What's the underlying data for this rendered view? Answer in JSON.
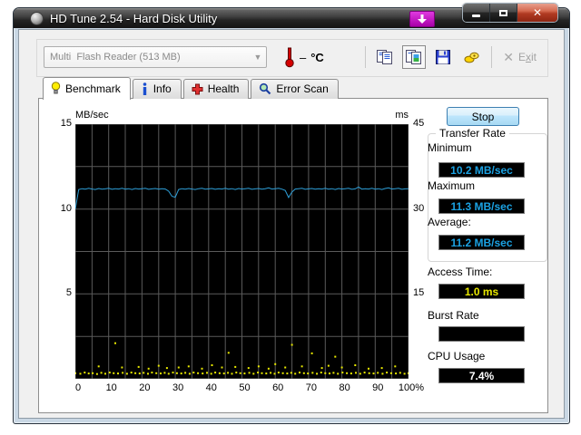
{
  "window": {
    "title": "HD Tune 2.54 - Hard Disk Utility"
  },
  "toolbar": {
    "device_select": "Multi  Flash Reader (513 MB)",
    "temperature": "–",
    "temperature_unit": "°C",
    "exit_label_pre": "E",
    "exit_label_underlined": "x",
    "exit_label_post": "it"
  },
  "tabs": [
    {
      "label": "Benchmark"
    },
    {
      "label": "Info"
    },
    {
      "label": "Health"
    },
    {
      "label": "Error Scan"
    }
  ],
  "controls": {
    "stop_button": "Stop"
  },
  "results": {
    "transfer_rate": {
      "group_label": "Transfer Rate",
      "minimum_label": "Minimum",
      "minimum_value": "10.2 MB/sec",
      "maximum_label": "Maximum",
      "maximum_value": "11.3 MB/sec",
      "average_label": "Average:",
      "average_value": "11.2 MB/sec"
    },
    "access_time_label": "Access Time:",
    "access_time_value": "1.0 ms",
    "burst_rate_label": "Burst Rate",
    "burst_rate_value": "",
    "cpu_usage_label": "CPU Usage",
    "cpu_usage_value": "7.4%"
  },
  "chart_data": {
    "type": "line",
    "left_axis": {
      "label": "MB/sec",
      "min": 0,
      "max": 15,
      "ticks": [
        15,
        10,
        5
      ]
    },
    "right_axis": {
      "label": "ms",
      "min": 0,
      "max": 45,
      "ticks": [
        45,
        30,
        15
      ]
    },
    "x_axis": {
      "min": 0,
      "max": 100,
      "tick_labels": [
        "0",
        "10",
        "20",
        "30",
        "40",
        "50",
        "60",
        "70",
        "80",
        "90",
        "100%"
      ]
    },
    "grid": {
      "x_divisions": 20,
      "y_divisions": 6,
      "line_color": "#5a5a5a",
      "bg_color": "#000000"
    },
    "series": [
      {
        "name": "transfer-rate",
        "type": "line",
        "axis": "left",
        "color": "#2e9fd8",
        "x_start": 0,
        "x_step": 1,
        "values": [
          10.0,
          11.15,
          11.2,
          11.17,
          11.22,
          11.18,
          11.15,
          11.21,
          11.17,
          11.19,
          11.22,
          11.16,
          11.2,
          11.18,
          11.22,
          11.17,
          11.2,
          11.15,
          11.21,
          11.18,
          11.2,
          11.22,
          11.16,
          11.19,
          11.21,
          11.17,
          11.2,
          11.18,
          11.05,
          10.75,
          10.7,
          11.15,
          11.2,
          11.17,
          11.21,
          11.18,
          11.15,
          11.2,
          11.22,
          11.17,
          11.19,
          11.21,
          11.16,
          11.2,
          11.18,
          11.22,
          11.17,
          11.2,
          11.15,
          11.21,
          11.18,
          11.2,
          11.22,
          11.16,
          11.19,
          11.21,
          11.17,
          11.2,
          11.25,
          11.18,
          11.2,
          11.22,
          11.17,
          11.1,
          10.68,
          11.0,
          11.18,
          11.2,
          11.22,
          11.16,
          11.19,
          11.21,
          11.17,
          11.2,
          11.18,
          11.22,
          11.17,
          11.2,
          11.15,
          11.21,
          11.18,
          11.2,
          11.22,
          11.16,
          11.19,
          11.3,
          11.17,
          11.2,
          11.18,
          11.22,
          11.17,
          11.2,
          11.15,
          11.21,
          11.25,
          11.18,
          11.2,
          11.22,
          11.16,
          11.19,
          11.2
        ]
      },
      {
        "name": "access-time",
        "type": "scatter",
        "axis": "right",
        "color": "#e8e800",
        "points": [
          [
            0,
            1.0
          ],
          [
            1.5,
            0.9
          ],
          [
            2.8,
            1.1
          ],
          [
            4,
            0.95
          ],
          [
            5.2,
            1.0
          ],
          [
            6.5,
            0.85
          ],
          [
            7,
            2.2
          ],
          [
            7.8,
            1.05
          ],
          [
            9,
            0.9
          ],
          [
            10.3,
            1.1
          ],
          [
            11.5,
            1.0
          ],
          [
            12,
            6.3
          ],
          [
            12.8,
            0.95
          ],
          [
            14,
            2.0
          ],
          [
            14.2,
            1.05
          ],
          [
            15.5,
            0.9
          ],
          [
            16.8,
            1.1
          ],
          [
            18,
            1.0
          ],
          [
            19,
            2.1
          ],
          [
            19.3,
            0.95
          ],
          [
            20.5,
            1.05
          ],
          [
            21.8,
            0.9
          ],
          [
            22,
            1.8
          ],
          [
            23,
            1.1
          ],
          [
            24.3,
            1.0
          ],
          [
            25,
            2.3
          ],
          [
            25.6,
            0.95
          ],
          [
            26.8,
            1.05
          ],
          [
            27.5,
            1.9
          ],
          [
            28,
            0.9
          ],
          [
            29.3,
            1.1
          ],
          [
            30.5,
            1.0
          ],
          [
            31,
            2.0
          ],
          [
            31.8,
            0.95
          ],
          [
            33,
            1.05
          ],
          [
            34,
            2.2
          ],
          [
            34.3,
            0.9
          ],
          [
            35.5,
            1.1
          ],
          [
            36.8,
            1.0
          ],
          [
            38,
            1.8
          ],
          [
            38.2,
            0.95
          ],
          [
            39.5,
            1.05
          ],
          [
            40.8,
            0.9
          ],
          [
            41,
            2.4
          ],
          [
            42,
            1.1
          ],
          [
            43.3,
            1.0
          ],
          [
            44,
            2.0
          ],
          [
            44.6,
            0.95
          ],
          [
            45.8,
            1.05
          ],
          [
            46,
            4.6
          ],
          [
            47,
            0.9
          ],
          [
            48,
            2.1
          ],
          [
            48.3,
            1.1
          ],
          [
            49.5,
            1.0
          ],
          [
            50.8,
            0.95
          ],
          [
            52,
            1.9
          ],
          [
            52.2,
            1.05
          ],
          [
            53.5,
            0.9
          ],
          [
            54.8,
            1.1
          ],
          [
            55,
            2.2
          ],
          [
            56,
            1.0
          ],
          [
            57.3,
            0.95
          ],
          [
            58,
            1.8
          ],
          [
            58.6,
            1.05
          ],
          [
            59.8,
            0.9
          ],
          [
            60,
            2.6
          ],
          [
            61,
            1.1
          ],
          [
            62.3,
            1.0
          ],
          [
            63,
            2.0
          ],
          [
            63.6,
            0.95
          ],
          [
            64.8,
            1.05
          ],
          [
            65,
            6.0
          ],
          [
            66,
            0.9
          ],
          [
            67.3,
            1.1
          ],
          [
            68,
            2.2
          ],
          [
            68.6,
            1.0
          ],
          [
            69.8,
            0.95
          ],
          [
            71,
            4.5
          ],
          [
            71.2,
            1.05
          ],
          [
            72.5,
            0.9
          ],
          [
            73.8,
            1.1
          ],
          [
            74,
            1.9
          ],
          [
            75,
            1.0
          ],
          [
            76,
            2.3
          ],
          [
            76.3,
            0.95
          ],
          [
            77.5,
            1.05
          ],
          [
            78,
            3.9
          ],
          [
            78.8,
            0.9
          ],
          [
            80,
            2.0
          ],
          [
            80.2,
            1.1
          ],
          [
            81.5,
            1.0
          ],
          [
            82.8,
            0.95
          ],
          [
            84,
            2.4
          ],
          [
            84.2,
            1.05
          ],
          [
            85.5,
            0.9
          ],
          [
            86.8,
            1.1
          ],
          [
            88,
            1.8
          ],
          [
            88.2,
            1.0
          ],
          [
            89.5,
            0.95
          ],
          [
            90.8,
            1.05
          ],
          [
            92,
            1.9
          ],
          [
            92.2,
            0.9
          ],
          [
            93.5,
            1.1
          ],
          [
            94.8,
            1.0
          ],
          [
            96,
            2.2
          ],
          [
            96.2,
            0.95
          ],
          [
            97.5,
            1.05
          ],
          [
            98.8,
            0.9
          ],
          [
            100,
            1.0
          ]
        ]
      }
    ]
  }
}
